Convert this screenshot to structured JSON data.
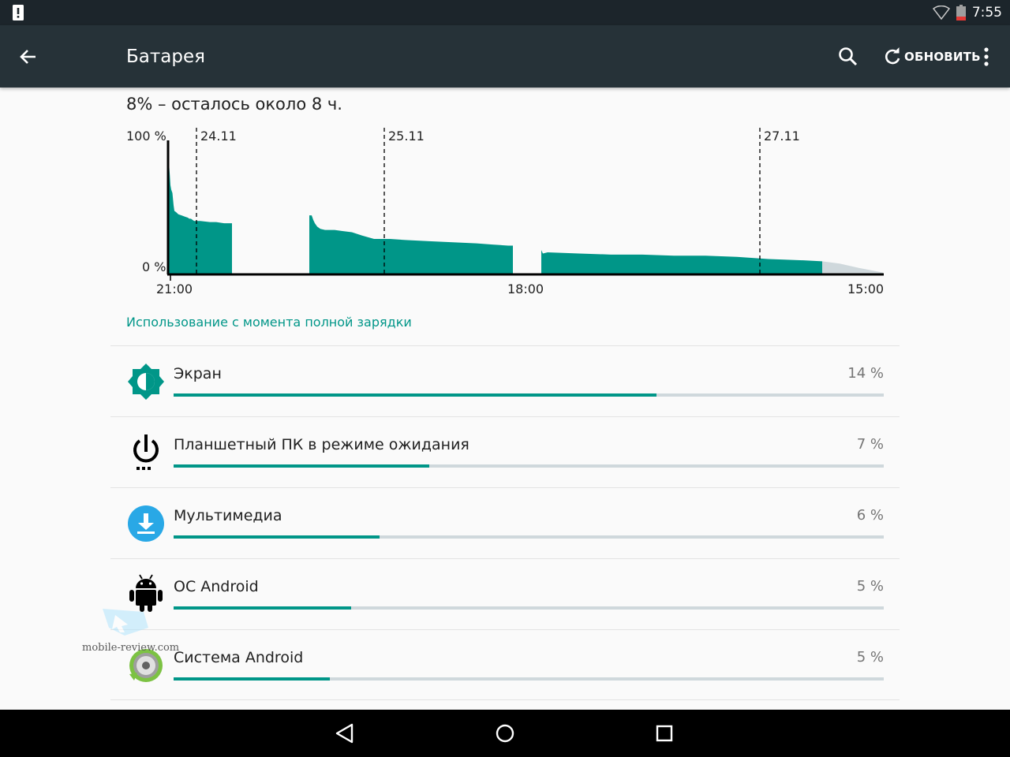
{
  "status_bar": {
    "time": "7:55",
    "icons": [
      "alert-icon",
      "wifi-icon",
      "battery-low-icon"
    ]
  },
  "action_bar": {
    "title": "Батарея",
    "back_icon": "arrow-back-icon",
    "search_icon": "search-icon",
    "refresh_label": "ОБНОВИТЬ",
    "refresh_icon": "refresh-icon",
    "overflow_icon": "more-vert-icon"
  },
  "summary": "8% – осталось около 8 ч.",
  "chart_data": {
    "type": "area",
    "y_labels": [
      "100 %",
      "0 %"
    ],
    "x_labels": [
      "21:00",
      "18:00",
      "15:00"
    ],
    "date_markers": [
      "24.11",
      "25.11",
      "27.11"
    ],
    "series_color": "#009688",
    "prediction_color": "#cfd8dc",
    "ylim": [
      0,
      100
    ],
    "segments": [
      [
        [
          0,
          100
        ],
        [
          0.4,
          96
        ],
        [
          1.2,
          88
        ],
        [
          2,
          79
        ],
        [
          3,
          75
        ],
        [
          4.5,
          72
        ],
        [
          6,
          61
        ],
        [
          7,
          56
        ],
        [
          9,
          55
        ],
        [
          12,
          53
        ],
        [
          16,
          52
        ],
        [
          20,
          51
        ],
        [
          24,
          50
        ],
        [
          26,
          49
        ],
        [
          28,
          49
        ],
        [
          32,
          47
        ],
        [
          40,
          47
        ],
        [
          52,
          46
        ],
        [
          60,
          46
        ],
        [
          70,
          45
        ],
        [
          80,
          45
        ]
      ],
      [
        [
          178,
          52
        ],
        [
          181,
          52
        ],
        [
          183,
          48
        ],
        [
          185,
          45
        ],
        [
          188,
          42
        ],
        [
          192,
          40
        ],
        [
          198,
          39
        ],
        [
          210,
          39
        ],
        [
          220,
          38
        ],
        [
          232,
          37
        ],
        [
          245,
          34
        ],
        [
          260,
          31
        ],
        [
          280,
          31
        ],
        [
          300,
          30
        ],
        [
          330,
          29
        ],
        [
          360,
          28
        ],
        [
          390,
          27
        ],
        [
          410,
          26
        ],
        [
          430,
          25
        ],
        [
          436,
          25
        ]
      ],
      [
        [
          472,
          21
        ],
        [
          474,
          18
        ],
        [
          480,
          19
        ],
        [
          520,
          18
        ],
        [
          560,
          17
        ],
        [
          600,
          17
        ],
        [
          640,
          16
        ],
        [
          680,
          16
        ],
        [
          720,
          15
        ],
        [
          760,
          13
        ],
        [
          800,
          12
        ],
        [
          828,
          11
        ]
      ]
    ],
    "prediction": [
      [
        828,
        11
      ],
      [
        850,
        9
      ],
      [
        875,
        5
      ],
      [
        905,
        1
      ]
    ]
  },
  "section_header": "Использование с момента полной зарядки",
  "usage_items": [
    {
      "icon": "screen-brightness-icon",
      "label": "Экран",
      "percent": "14 %",
      "fill": 0.68
    },
    {
      "icon": "power-standby-icon",
      "label": "Планшетный ПК в режиме ожидания",
      "percent": "7 %",
      "fill": 0.36
    },
    {
      "icon": "download-icon",
      "label": "Мультимедиа",
      "percent": "6 %",
      "fill": 0.29
    },
    {
      "icon": "android-robot-icon",
      "label": "ОС Android",
      "percent": "5 %",
      "fill": 0.25
    },
    {
      "icon": "android-system-icon",
      "label": "Система Android",
      "percent": "5 %",
      "fill": 0.22
    }
  ],
  "watermark": "mobile-review.com",
  "nav_bar": {
    "icons": [
      "nav-back-icon",
      "nav-home-icon",
      "nav-recents-icon"
    ]
  }
}
